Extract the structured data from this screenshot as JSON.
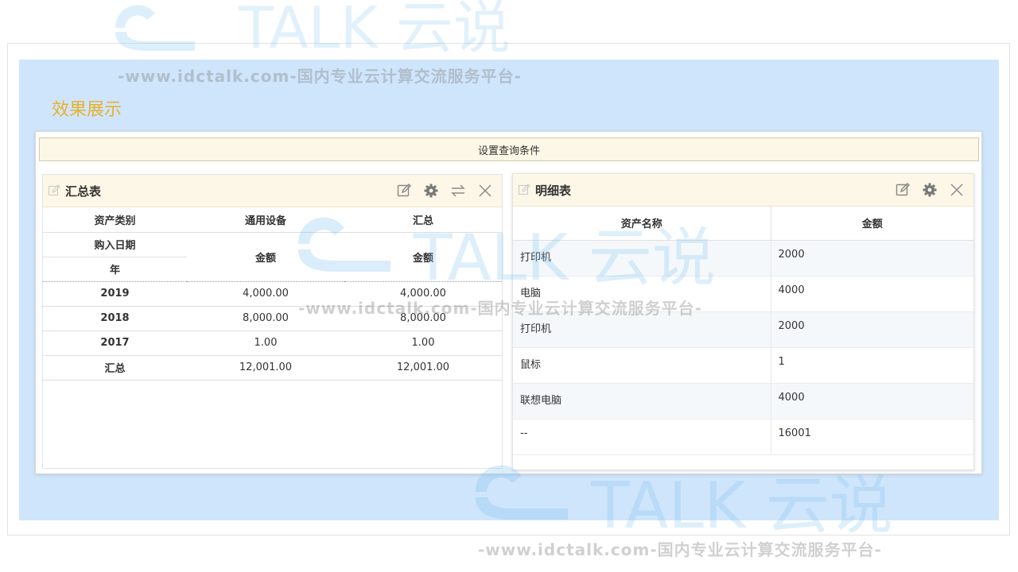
{
  "section_title": "效果展示",
  "query_bar": {
    "label": "设置查询条件"
  },
  "summary": {
    "title": "汇总表",
    "header_row1": [
      "资产类别",
      "通用设备",
      "汇总"
    ],
    "header_row2_left": "购入日期",
    "header_row3_left": "年",
    "header_amount_1": "金额",
    "header_amount_2": "金额",
    "rows": [
      {
        "year": "2019",
        "general": "4,000.00",
        "total": "4,000.00"
      },
      {
        "year": "2018",
        "general": "8,000.00",
        "total": "8,000.00"
      },
      {
        "year": "2017",
        "general": "1.00",
        "total": "1.00"
      },
      {
        "year": "汇总",
        "general": "12,001.00",
        "total": "12,001.00"
      }
    ]
  },
  "detail": {
    "title": "明细表",
    "columns": [
      "资产名称",
      "金额"
    ],
    "rows": [
      {
        "name": "打印机",
        "amount": "2000"
      },
      {
        "name": "电脑",
        "amount": "4000"
      },
      {
        "name": "打印机",
        "amount": "2000"
      },
      {
        "name": "鼠标",
        "amount": "1"
      },
      {
        "name": "联想电脑",
        "amount": "4000"
      },
      {
        "name": "--",
        "amount": "16001"
      }
    ]
  },
  "watermark": {
    "brand": "TALK 云说",
    "url_line": "-www.idctalk.com-国内专业云计算交流服务平台-"
  },
  "colors": {
    "accent": "#e7b12c",
    "panel_header_bg": "#fcf7e6",
    "canvas_bg": "#cfe5fb"
  }
}
